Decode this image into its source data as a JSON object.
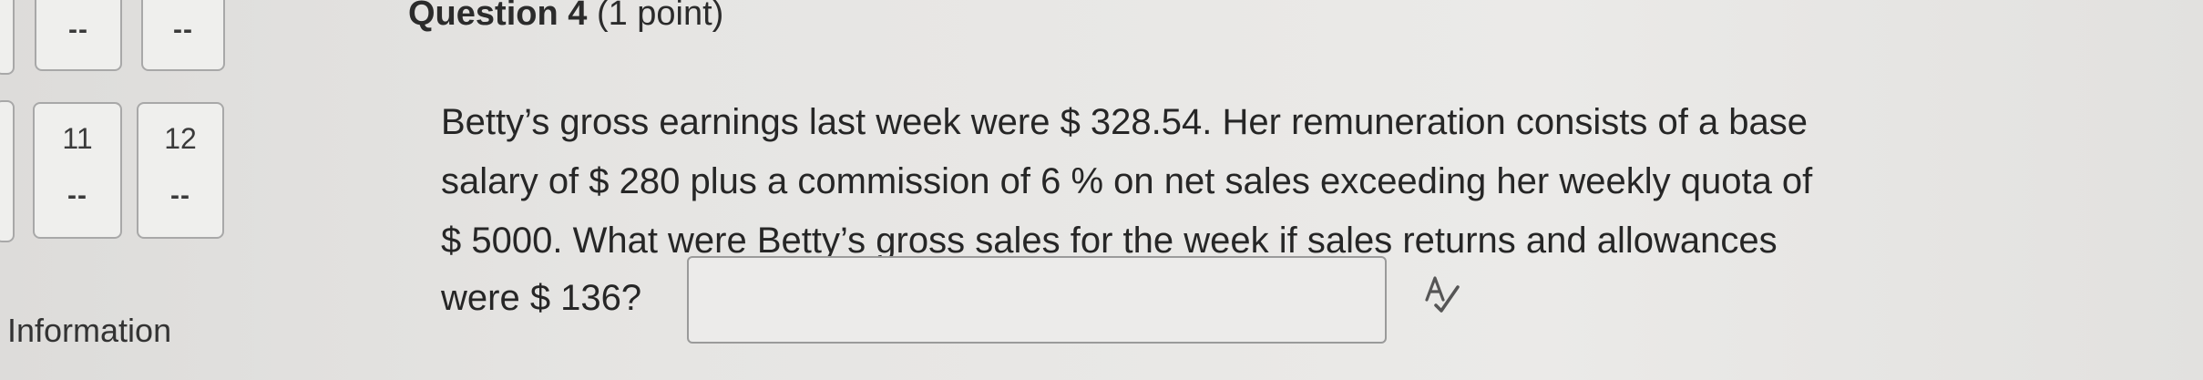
{
  "nav": {
    "tiles_top": [
      {
        "status": "--"
      },
      {
        "status": "--"
      }
    ],
    "tiles": [
      {
        "number": "11",
        "status": "--"
      },
      {
        "number": "12",
        "status": "--"
      }
    ],
    "section_label": "Information"
  },
  "question": {
    "title": "Question 4",
    "points": "(1 point)",
    "lines": [
      "Betty’s gross earnings last week were $ 328.54. Her remuneration consists of a base",
      "salary of $ 280 plus a commission of 6 % on net sales exceeding her weekly quota of",
      "$ 5000. What were Betty’s gross sales for the week if sales returns and allowances"
    ],
    "answer_lead": "were $ 136?",
    "answer_value": "",
    "spellcheck_icon": "spellcheck-icon"
  }
}
